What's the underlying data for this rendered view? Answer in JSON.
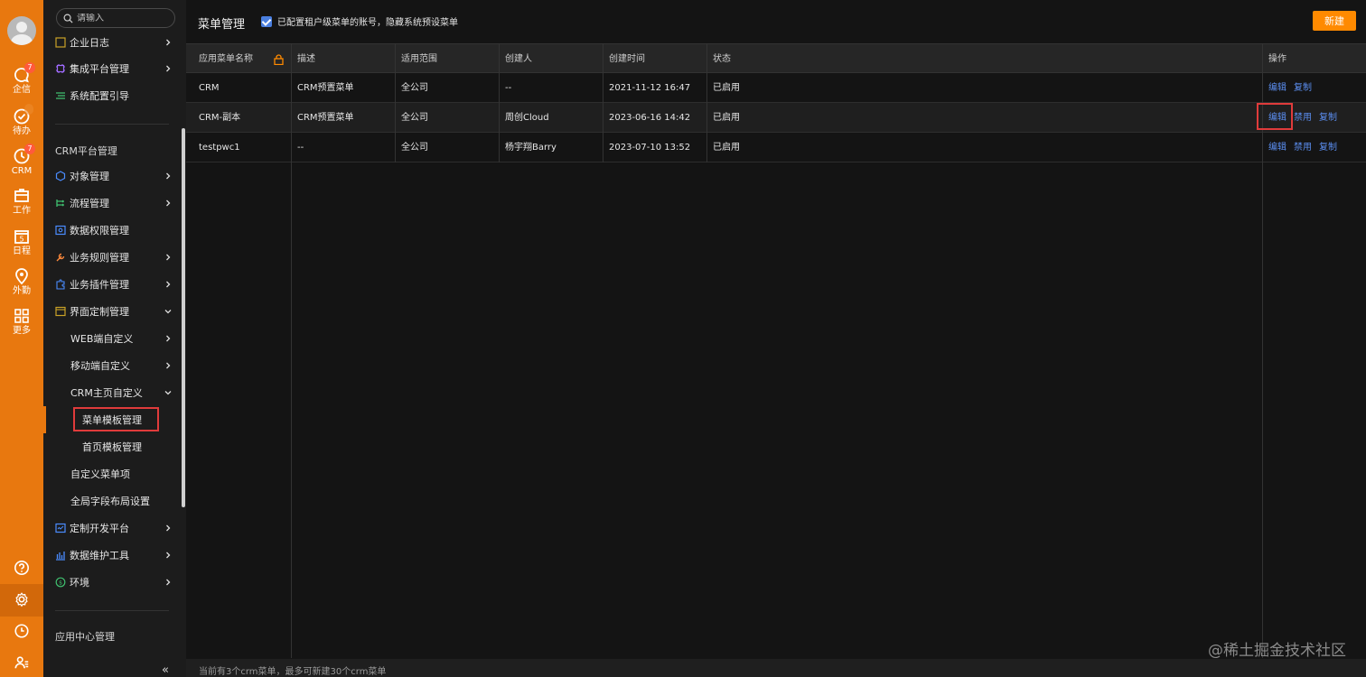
{
  "rail": {
    "items": [
      {
        "label": "企信",
        "badge": "7"
      },
      {
        "label": "待办",
        "badge": ""
      },
      {
        "label": "CRM",
        "badge": "7"
      },
      {
        "label": "工作"
      },
      {
        "label": "日程",
        "date_num": "5"
      },
      {
        "label": "外勤"
      },
      {
        "label": "更多"
      }
    ]
  },
  "sidebar": {
    "search_placeholder": "请输入",
    "top_items": [
      "企业日志",
      "集成平台管理",
      "系统配置引导"
    ],
    "section_crm": "CRM平台管理",
    "crm_items": [
      "对象管理",
      "流程管理",
      "数据权限管理",
      "业务规则管理",
      "业务插件管理",
      "界面定制管理"
    ],
    "ui_sub": [
      "WEB端自定义",
      "移动端自定义",
      "CRM主页自定义"
    ],
    "crm_home_sub": [
      "菜单模板管理",
      "首页模板管理"
    ],
    "ui_sub2": [
      "自定义菜单项",
      "全局字段布局设置"
    ],
    "tail_items": [
      "定制开发平台",
      "数据维护工具",
      "环境"
    ],
    "section_app": "应用中心管理",
    "collapse_glyph": "«"
  },
  "header": {
    "title": "菜单管理",
    "checkbox_label": "已配置租户级菜单的账号，隐藏系统预设菜单",
    "new_button": "新建"
  },
  "table": {
    "columns": [
      "应用菜单名称",
      "描述",
      "适用范围",
      "创建人",
      "创建时间",
      "状态",
      "操作"
    ],
    "rows": [
      {
        "name": "CRM",
        "desc": "CRM预置菜单",
        "scope": "全公司",
        "creator": "--",
        "created": "2021-11-12 16:47",
        "status": "已启用",
        "ops": [
          "编辑",
          "复制"
        ]
      },
      {
        "name": "CRM-副本",
        "desc": "CRM预置菜单",
        "scope": "全公司",
        "creator": "周创Cloud",
        "created": "2023-06-16 14:42",
        "status": "已启用",
        "ops": [
          "编辑",
          "禁用",
          "复制"
        ]
      },
      {
        "name": "testpwc1",
        "desc": "--",
        "scope": "全公司",
        "creator": "杨宇翔Barry",
        "created": "2023-07-10 13:52",
        "status": "已启用",
        "ops": [
          "编辑",
          "禁用",
          "复制"
        ]
      }
    ]
  },
  "footer": {
    "text": "当前有3个crm菜单，最多可新建30个crm菜单"
  },
  "watermark": "@稀土掘金技术社区",
  "colors": {
    "rail": "#e8780f",
    "accent": "#ff8a00",
    "link": "#5b8ef0",
    "highlight": "#e03b3b"
  }
}
